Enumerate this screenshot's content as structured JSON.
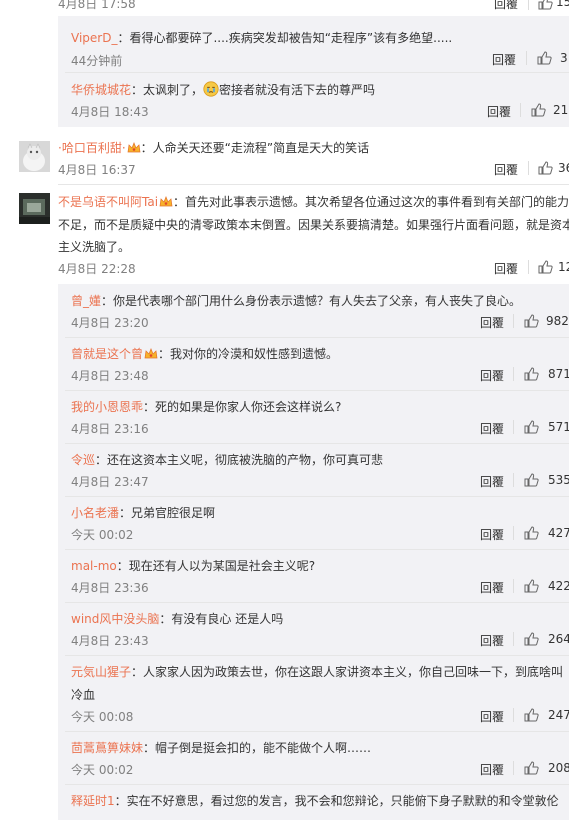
{
  "reply_label": "回覆",
  "top_row": {
    "time": "4月8日 17:58",
    "likes": "15"
  },
  "nested_top": [
    {
      "user": "ViperD_",
      "text": "：看得心都要碎了....疾病突发却被告知“走程序”该有多绝望.....",
      "time": "44分钟前",
      "likes": "3"
    },
    {
      "user": "华侨城城花",
      "text_before": "：太讽刺了，",
      "text_after": "密接者就没有活下去的尊严吗",
      "time": "4月8日 18:43",
      "likes": "21"
    }
  ],
  "comment1": {
    "user": "·哈口百利甜·",
    "text": "：人命关天还要“走流程”简直是天大的笑话",
    "time": "4月8日 16:37",
    "likes": "36"
  },
  "comment2": {
    "user": "不是乌语不叫阿Tai",
    "lines": [
      "：首先对此事表示遗憾。其次希望各位通过这次的事件看到有关部门的能力",
      "不足，而不是质疑中央的清零政策本末倒置。因果关系要搞清楚。如果强行片面看问题，就是资本",
      "主义洗脑了。"
    ],
    "time": "4月8日 22:28",
    "likes": "12"
  },
  "replies": [
    {
      "user": "曾_嬞",
      "lines": [
        "：你是代表哪个部门用什么身份表示遗憾？有人失去了父亲，有人丧失了良心。"
      ],
      "time": "4月8日 23:20",
      "likes": "982",
      "badge": false
    },
    {
      "user": "曾就是这个曾",
      "lines": [
        "：我对你的冷漠和奴性感到遗憾。"
      ],
      "time": "4月8日 23:48",
      "likes": "871",
      "badge": true
    },
    {
      "user": "我的小恩恩乖",
      "lines": [
        "：死的如果是你家人你还会这样说么?"
      ],
      "time": "4月8日 23:16",
      "likes": "571",
      "badge": false
    },
    {
      "user": "令巡",
      "lines": [
        "：还在这资本主义呢，彻底被洗脑的产物，你可真可悲"
      ],
      "time": "4月8日 23:47",
      "likes": "535",
      "badge": false
    },
    {
      "user": "小名老潘",
      "lines": [
        "：兄弟官腔很足啊"
      ],
      "time": "今天 00:02",
      "likes": "427",
      "badge": false
    },
    {
      "user": "mal-mo",
      "lines": [
        "：现在还有人以为某国是社会主义呢?"
      ],
      "time": "4月8日 23:36",
      "likes": "422",
      "badge": false
    },
    {
      "user": "wind风中没头脑",
      "lines": [
        "：有没有良心 还是人吗"
      ],
      "time": "4月8日 23:43",
      "likes": "264",
      "badge": false
    },
    {
      "user": "元気山猩子",
      "lines": [
        "：人家家人因为政策去世，你在这跟人家讲资本主义，你自己回味一下，到底啥叫",
        "冷血"
      ],
      "time": "今天 00:08",
      "likes": "247",
      "badge": false
    },
    {
      "user": "茴蒿蔦箅妹妹",
      "lines": [
        "：帽子倒是挺会扣的，能不能做个人啊……"
      ],
      "time": "今天 00:02",
      "likes": "208",
      "badge": false
    },
    {
      "user": "释延时1",
      "lines": [
        "：实在不好意思，看过您的发言，我不会和您辩论，只能俯下身子默默的和令堂敦伦"
      ],
      "time": "",
      "likes": "",
      "badge": false
    }
  ]
}
